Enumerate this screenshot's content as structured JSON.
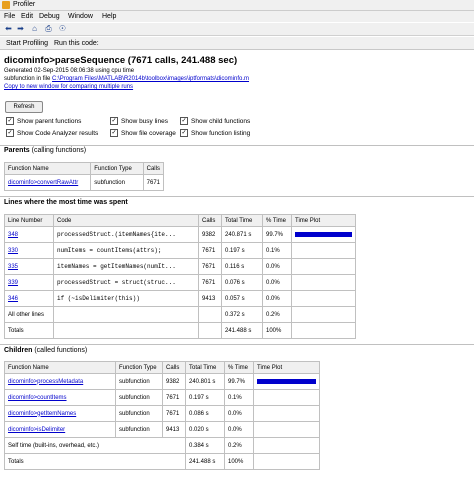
{
  "window": {
    "title": "Profiler"
  },
  "menu": [
    "File",
    "Edit",
    "Debug",
    "Window",
    "Help"
  ],
  "toolbar": {
    "start_profiling": "Start Profiling",
    "run_this_code": "Run this code:"
  },
  "header": {
    "title": "dicominfo>parseSequence (7671 calls, 241.488 sec)",
    "generated": "Generated 02-Sep-2015 08:06:38 using cpu time",
    "subfunction_prefix": "subfunction in file",
    "file_path": "C:\\Program Files\\MATLAB\\R2014b\\toolbox\\images\\iptformats\\dicominfo.m",
    "compare_link": "Copy to new window for comparing multiple runs"
  },
  "refresh_label": "Refresh",
  "options": [
    {
      "label": "Show parent functions",
      "checked": true
    },
    {
      "label": "Show busy lines",
      "checked": true
    },
    {
      "label": "Show child functions",
      "checked": true
    },
    {
      "label": "Show Code Analyzer results",
      "checked": true
    },
    {
      "label": "Show file coverage",
      "checked": true
    },
    {
      "label": "Show function listing",
      "checked": true
    }
  ],
  "parents": {
    "title": "Parents",
    "subtitle": "(calling functions)",
    "headers": [
      "Function Name",
      "Function Type",
      "Calls"
    ],
    "rows": [
      {
        "name": "dicominfo>convertRawAttr",
        "type": "subfunction",
        "calls": "7671"
      }
    ]
  },
  "lines": {
    "title": "Lines where the most time was spent",
    "headers": [
      "Line Number",
      "Code",
      "Calls",
      "Total Time",
      "% Time",
      "Time Plot"
    ],
    "rows": [
      {
        "line": "348",
        "code": "processedStruct.(itemNames{ite...",
        "calls": "9382",
        "time": "240.871 s",
        "pct": "99.7%",
        "frac": 0.997
      },
      {
        "line": "330",
        "code": "numItems = countItems(attrs);",
        "calls": "7671",
        "time": "0.197 s",
        "pct": "0.1%",
        "frac": 0.001
      },
      {
        "line": "335",
        "code": "itemNames = getItemNames(numIt...",
        "calls": "7671",
        "time": "0.116 s",
        "pct": "0.0%",
        "frac": 0
      },
      {
        "line": "339",
        "code": "processedStruct = struct(struc...",
        "calls": "7671",
        "time": "0.076 s",
        "pct": "0.0%",
        "frac": 0
      },
      {
        "line": "346",
        "code": "if (~isDelimiter(this))",
        "calls": "9413",
        "time": "0.057 s",
        "pct": "0.0%",
        "frac": 0
      }
    ],
    "other": {
      "label": "All other lines",
      "time": "0.372 s",
      "pct": "0.2%"
    },
    "totals": {
      "label": "Totals",
      "time": "241.488 s",
      "pct": "100%"
    }
  },
  "children": {
    "title": "Children",
    "subtitle": "(called functions)",
    "headers": [
      "Function Name",
      "Function Type",
      "Calls",
      "Total Time",
      "% Time",
      "Time Plot"
    ],
    "rows": [
      {
        "name": "dicominfo>processMetadata",
        "type": "subfunction",
        "calls": "9382",
        "time": "240.801 s",
        "pct": "99.7%",
        "frac": 0.997
      },
      {
        "name": "dicominfo>countItems",
        "type": "subfunction",
        "calls": "7671",
        "time": "0.197 s",
        "pct": "0.1%",
        "frac": 0.001
      },
      {
        "name": "dicominfo>getItemNames",
        "type": "subfunction",
        "calls": "7671",
        "time": "0.086 s",
        "pct": "0.0%",
        "frac": 0
      },
      {
        "name": "dicominfo>isDelimiter",
        "type": "subfunction",
        "calls": "9413",
        "time": "0.020 s",
        "pct": "0.0%",
        "frac": 0
      }
    ],
    "self": {
      "label": "Self time (built-ins, overhead, etc.)",
      "time": "0.384 s",
      "pct": "0.2%"
    },
    "totals": {
      "label": "Totals",
      "time": "241.488 s",
      "pct": "100%"
    }
  },
  "colors": {
    "bar": "#0000cc",
    "link": "#0000cc"
  },
  "icons": [
    "back-icon",
    "forward-icon",
    "home-icon",
    "print-icon",
    "find-icon"
  ]
}
